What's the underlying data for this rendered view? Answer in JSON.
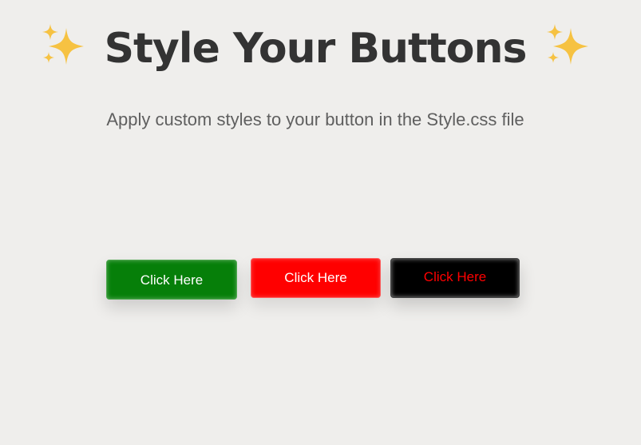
{
  "header": {
    "title": "Style Your Buttons",
    "sparkle_icon": "sparkles-icon",
    "sparkle_color": "#f6c242",
    "subtitle": "Apply custom styles to your button in the Style.css file"
  },
  "buttons": [
    {
      "label": "Click Here",
      "background": "#067f09",
      "text_color": "#ffffff"
    },
    {
      "label": "Click Here",
      "background": "#ff0000",
      "text_color": "#ffffff"
    },
    {
      "label": "Click Here",
      "background": "#000000",
      "text_color": "#ff0000"
    }
  ],
  "colors": {
    "page_background": "#efeeec",
    "title_color": "#333333",
    "subtitle_color": "#5f5f5f"
  }
}
